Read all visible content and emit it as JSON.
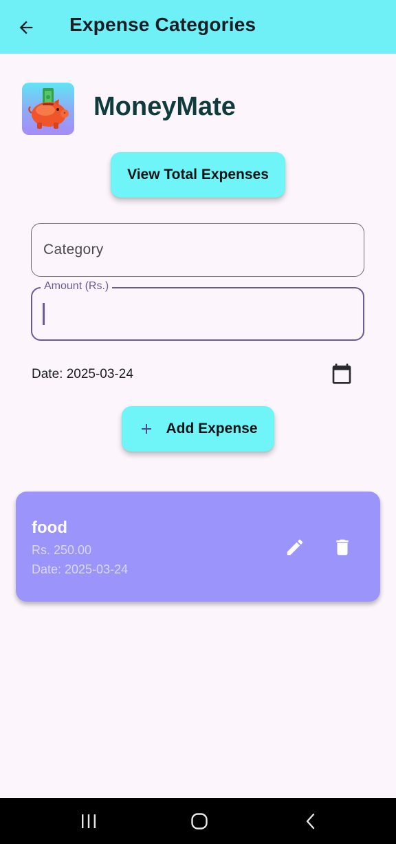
{
  "app_bar": {
    "title": "Expense Categories",
    "back_icon": "arrow-back-icon",
    "background": "#6ff0f7"
  },
  "brand": {
    "name": "MoneyMate",
    "logo_icon": "piggy-bank-icon"
  },
  "actions": {
    "view_total_label": "View Total Expenses",
    "add_expense_label": "Add Expense",
    "add_icon": "plus-icon",
    "button_color": "#6ff4f8"
  },
  "form": {
    "category": {
      "placeholder": "Category",
      "value": ""
    },
    "amount": {
      "label": "Amount (Rs.)",
      "value": ""
    },
    "date_text": "Date: 2025-03-24",
    "calendar_icon": "calendar-icon"
  },
  "expenses": [
    {
      "category": "food",
      "amount": "Rs. 250.00",
      "date": "Date: 2025-03-24",
      "edit_icon": "pencil-icon",
      "delete_icon": "trash-icon",
      "card_color": "#9b94fb"
    }
  ],
  "system_nav": {
    "recent_icon": "recent-apps-icon",
    "home_icon": "home-icon",
    "back_icon": "nav-back-icon"
  }
}
